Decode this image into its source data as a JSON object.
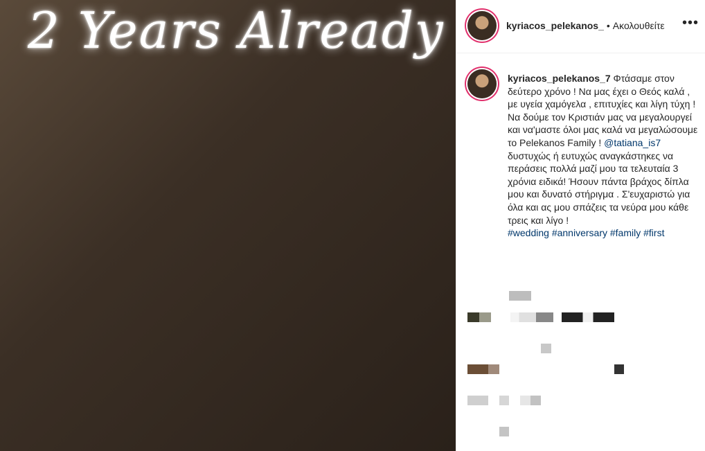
{
  "photo": {
    "overlay_text": "2 Years Already"
  },
  "header": {
    "username": "kyriacos_pelekanos_",
    "separator": "•",
    "follow_label": "Ακολουθείτε",
    "more_icon": "more-horizontal-icon"
  },
  "caption": {
    "username": "kyriacos_pelekanos_7",
    "text_1": "Φτάσαμε στον δεύτερο χρόνο ! Να μας έχει ο Θεός καλά , με υγεία χαμόγελα , επιτυχίες και λίγη τύχη ! Να δούμε τον Κριστιάν μας να μεγαλουργεί και να'μαστε όλοι μας καλά να μεγαλώσουμε το Pelekanos Family ! ",
    "mention": "@tatiana_is7",
    "text_2": " δυστυχώς ή ευτυχώς αναγκάστηκες να περάσεις πολλά μαζί μου τα τελευταία 3 χρόνια ειδικά! Ήσουν πάντα βράχος δίπλα μου και δυνατό στήριγμα . Σ'ευχαριστώ για όλα και ας μου σπάζεις τα νεύρα μου κάθε τρεις και λίγο !",
    "hashtags": [
      "#wedding",
      "#anniversary",
      "#family",
      "#first"
    ]
  }
}
